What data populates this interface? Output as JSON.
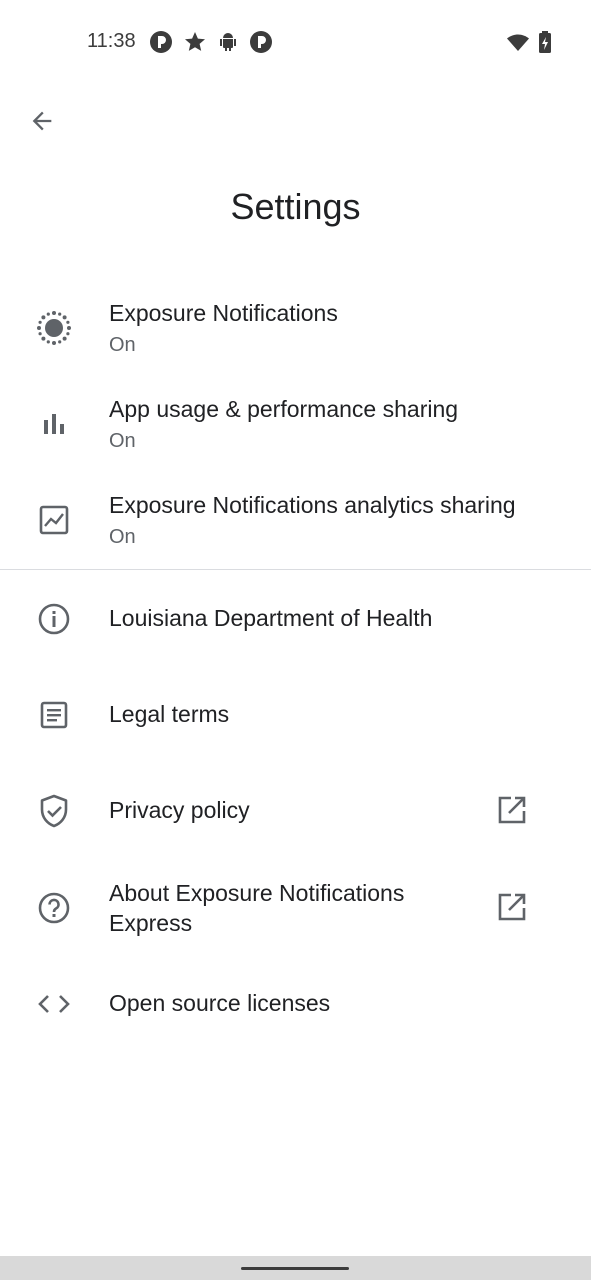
{
  "status_bar": {
    "time": "11:38",
    "notification_icons": [
      "app-notification-icon",
      "star-icon",
      "android-icon",
      "app-notification-icon"
    ],
    "system_icons": [
      "wifi-icon",
      "battery-icon"
    ]
  },
  "header": {
    "title": "Settings",
    "back_icon": "arrow-back-icon"
  },
  "settings": [
    {
      "title": "Exposure Notifications",
      "subtitle": "On",
      "icon": "exposure-icon"
    },
    {
      "title": "App usage & performance sharing",
      "subtitle": "On",
      "icon": "bar-chart-icon"
    },
    {
      "title": "Exposure Notifications analytics sharing",
      "subtitle": "On",
      "icon": "analytics-icon"
    }
  ],
  "links": [
    {
      "title": "Louisiana Department of Health",
      "icon": "info-icon"
    },
    {
      "title": "Legal terms",
      "icon": "document-icon"
    },
    {
      "title": "Privacy policy",
      "icon": "shield-icon",
      "external": true
    },
    {
      "title_line1": "About Exposure Notifications",
      "title_line2": "Express",
      "icon": "help-icon",
      "external": true
    },
    {
      "title": "Open source licenses",
      "icon": "code-icon"
    }
  ],
  "colors": {
    "background": "#ffffff",
    "text_primary": "#202124",
    "text_secondary": "#5f6368",
    "icon": "#5f6368",
    "divider": "#dadce0"
  }
}
